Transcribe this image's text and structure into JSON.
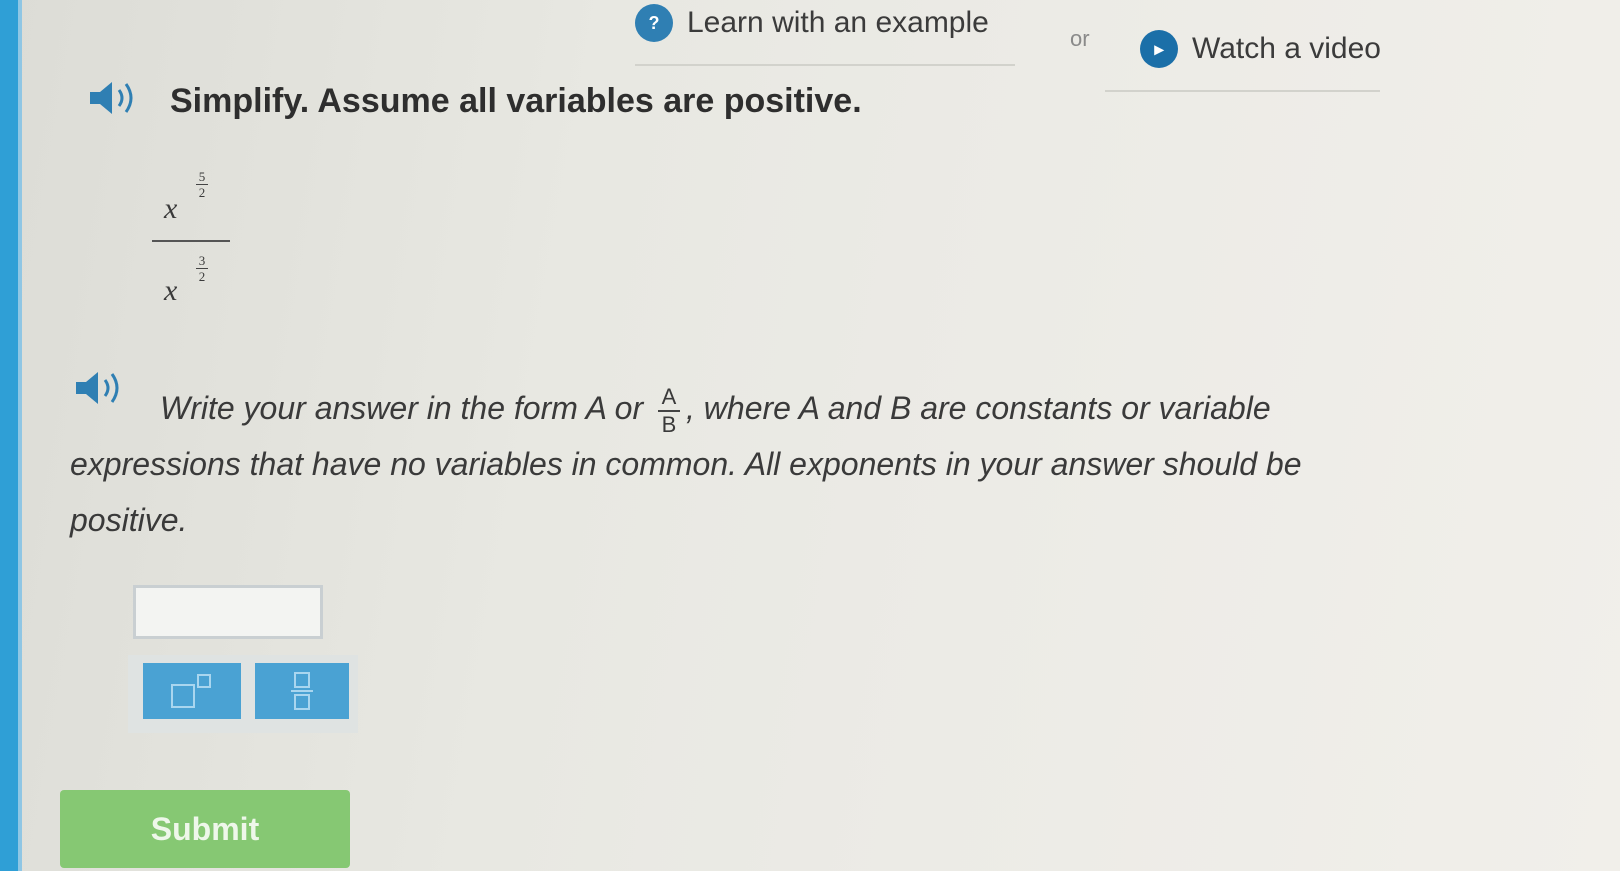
{
  "header": {
    "learn_label": "Learn with an example",
    "learn_icon": "lightbulb-icon",
    "or_label": "or",
    "video_label": "Watch a video",
    "video_icon": "play-icon"
  },
  "question": {
    "title": "Simplify. Assume all variables are positive.",
    "expression": {
      "numerator_base": "x",
      "numerator_exponent": {
        "num": "5",
        "den": "2"
      },
      "denominator_base": "x",
      "denominator_exponent": {
        "num": "3",
        "den": "2"
      }
    },
    "instruction_line1_a": "Write your answer in the form A or ",
    "instruction_frac_num": "A",
    "instruction_frac_den": "B",
    "instruction_line1_b": ", where A and B are constants or variable",
    "instruction_line2": "expressions that have no variables in common. All exponents in your answer should be",
    "instruction_line3": "positive."
  },
  "answer": {
    "value": ""
  },
  "tools": {
    "exponent_icon": "exponent-template-icon",
    "fraction_icon": "fraction-template-icon"
  },
  "submit_label": "Submit",
  "colors": {
    "accent": "#4aa2d3",
    "submit": "#86c873",
    "edge": "#2f9fd6"
  }
}
